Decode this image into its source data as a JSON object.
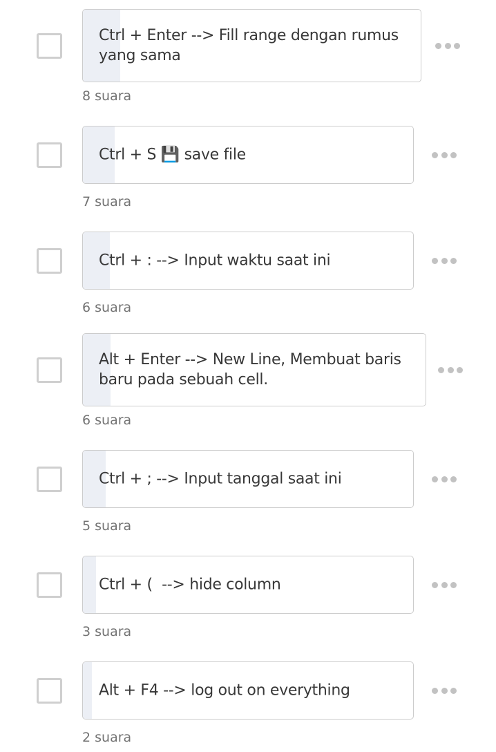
{
  "options": [
    {
      "text": "Ctrl + Enter --> Fill range dengan rumus yang sama",
      "votes": "8 suara",
      "bar_fill_pct": 10.8
    },
    {
      "text": "Ctrl + S 💾 save file",
      "votes": "7 suara",
      "bar_fill_pct": 9.5
    },
    {
      "text": "Ctrl + : --> Input waktu saat ini",
      "votes": "6 suara",
      "bar_fill_pct": 8.1
    },
    {
      "text": "Alt + Enter --> New Line, Membuat baris baru pada sebuah cell.",
      "votes": "6 suara",
      "bar_fill_pct": 8.1
    },
    {
      "text": "Ctrl + ; --> Input tanggal saat ini",
      "votes": "5 suara",
      "bar_fill_pct": 6.8
    },
    {
      "text": "Ctrl + (  --> hide column",
      "votes": "3 suara",
      "bar_fill_pct": 4.1
    },
    {
      "text": "Alt + F4 --> log out on everything",
      "votes": "2 suara",
      "bar_fill_pct": 2.7
    }
  ],
  "colors": {
    "bar_fill": "#eceff5",
    "border": "#cccccc",
    "icon": "#c2c2c2",
    "vote_text": "#737373"
  },
  "icons": {
    "checkbox": "checkbox-icon",
    "more": "more-options-icon"
  }
}
